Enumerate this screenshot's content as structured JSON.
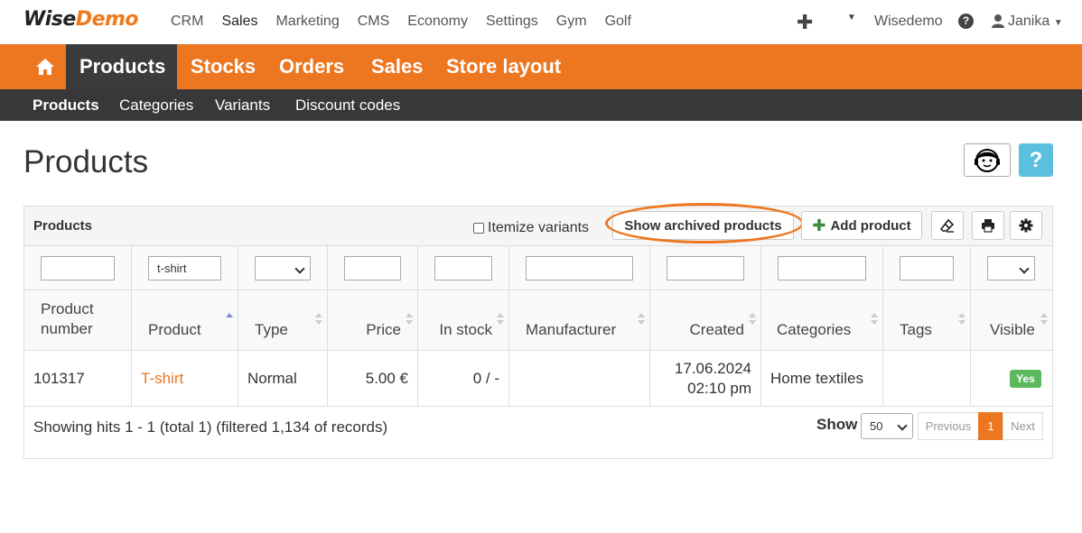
{
  "logo": {
    "part1": "Wise",
    "part2": "Demo"
  },
  "topnav": [
    "CRM",
    "Sales",
    "Marketing",
    "CMS",
    "Economy",
    "Settings",
    "Gym",
    "Golf"
  ],
  "top_right": {
    "company": "Wisedemo",
    "user": "Janika"
  },
  "mainnav": [
    "Products",
    "Stocks",
    "Orders",
    "Sales",
    "Store layout"
  ],
  "subnav": [
    "Products",
    "Categories",
    "Variants",
    "Discount codes"
  ],
  "page_title": "Products",
  "panel": {
    "title": "Products",
    "itemize_label": "Itemize variants",
    "show_archived": "Show archived products",
    "add_product": "Add product"
  },
  "filters": {
    "product": "t-shirt"
  },
  "columns": {
    "product_number": "Product number",
    "product": "Product",
    "type": "Type",
    "price": "Price",
    "in_stock": "In stock",
    "manufacturer": "Manufacturer",
    "created": "Created",
    "categories": "Categories",
    "tags": "Tags",
    "visible": "Visible"
  },
  "rows": [
    {
      "product_number": "101317",
      "product": "T-shirt",
      "type": "Normal",
      "price": "5.00 €",
      "in_stock": "0 / -",
      "manufacturer": "",
      "created_date": "17.06.2024",
      "created_time": "02:10 pm",
      "categories": "Home textiles",
      "tags": "",
      "visible": "Yes"
    }
  ],
  "footer": {
    "showing": "Showing hits 1 - 1 (total 1) (filtered 1,134 of records)",
    "show_label": "Show",
    "page_size": "50",
    "previous": "Previous",
    "page": "1",
    "next": "Next"
  },
  "colors": {
    "accent": "#ed7621",
    "dark_bar": "#383838",
    "success": "#5cb85c",
    "info": "#5bc0de"
  }
}
